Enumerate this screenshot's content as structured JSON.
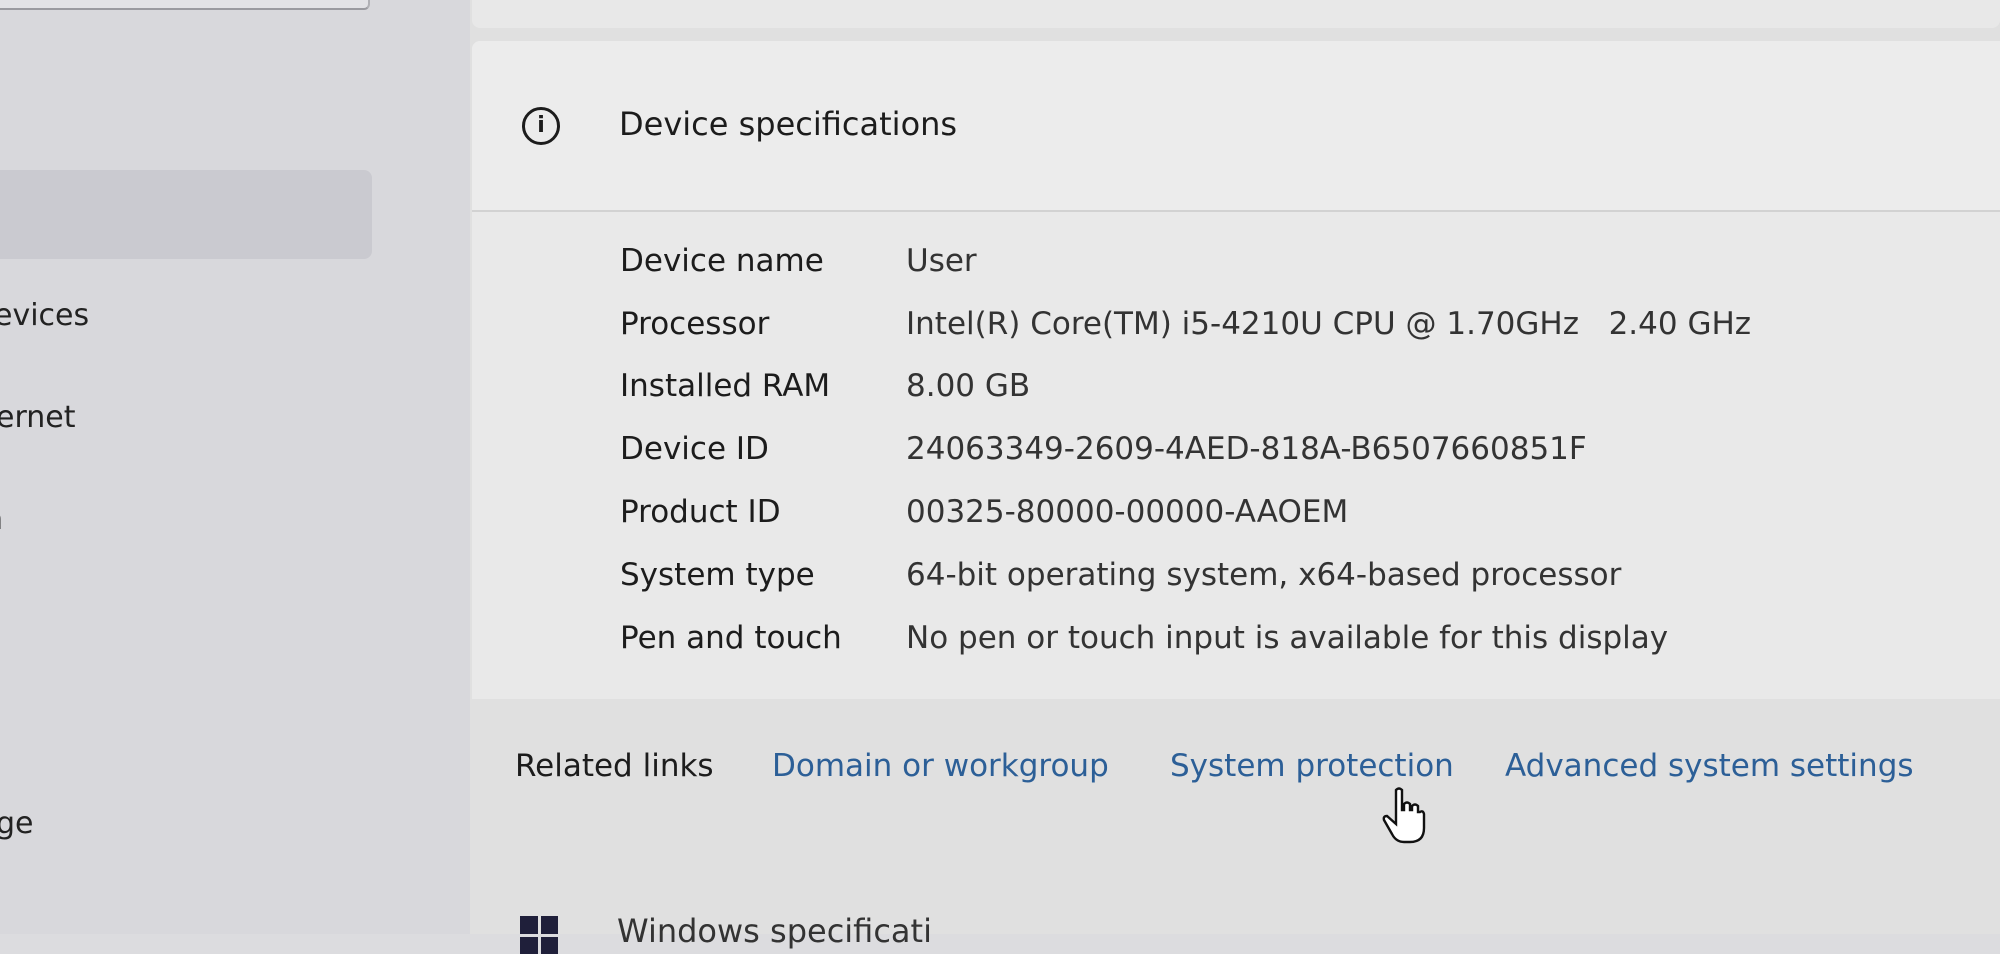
{
  "sidebar": {
    "items": [
      {
        "label": "evices"
      },
      {
        "label": "ernet"
      },
      {
        "label": "n"
      },
      {
        "label": "ge"
      }
    ]
  },
  "device_specifications": {
    "title": "Device specifications",
    "icon": "info-icon",
    "rows": [
      {
        "label": "Device name",
        "value": "User"
      },
      {
        "label": "Processor",
        "value": "Intel(R) Core(TM) i5-4210U CPU @ 1.70GHz   2.40 GHz"
      },
      {
        "label": "Installed RAM",
        "value": "8.00 GB"
      },
      {
        "label": "Device ID",
        "value": "24063349-2609-4AED-818A-B6507660851F"
      },
      {
        "label": "Product ID",
        "value": "00325-80000-00000-AAOEM"
      },
      {
        "label": "System type",
        "value": "64-bit operating system, x64-based processor"
      },
      {
        "label": "Pen and touch",
        "value": "No pen or touch input is available for this display"
      }
    ]
  },
  "related_links": {
    "label": "Related links",
    "links": [
      {
        "label": "Domain or workgroup"
      },
      {
        "label": "System protection"
      },
      {
        "label": "Advanced system settings"
      }
    ]
  },
  "next_section": {
    "title": "Windows specificati",
    "icon": "windows-logo-icon"
  },
  "colors": {
    "link": "#2c5f97",
    "text": "#1c1c1c"
  }
}
